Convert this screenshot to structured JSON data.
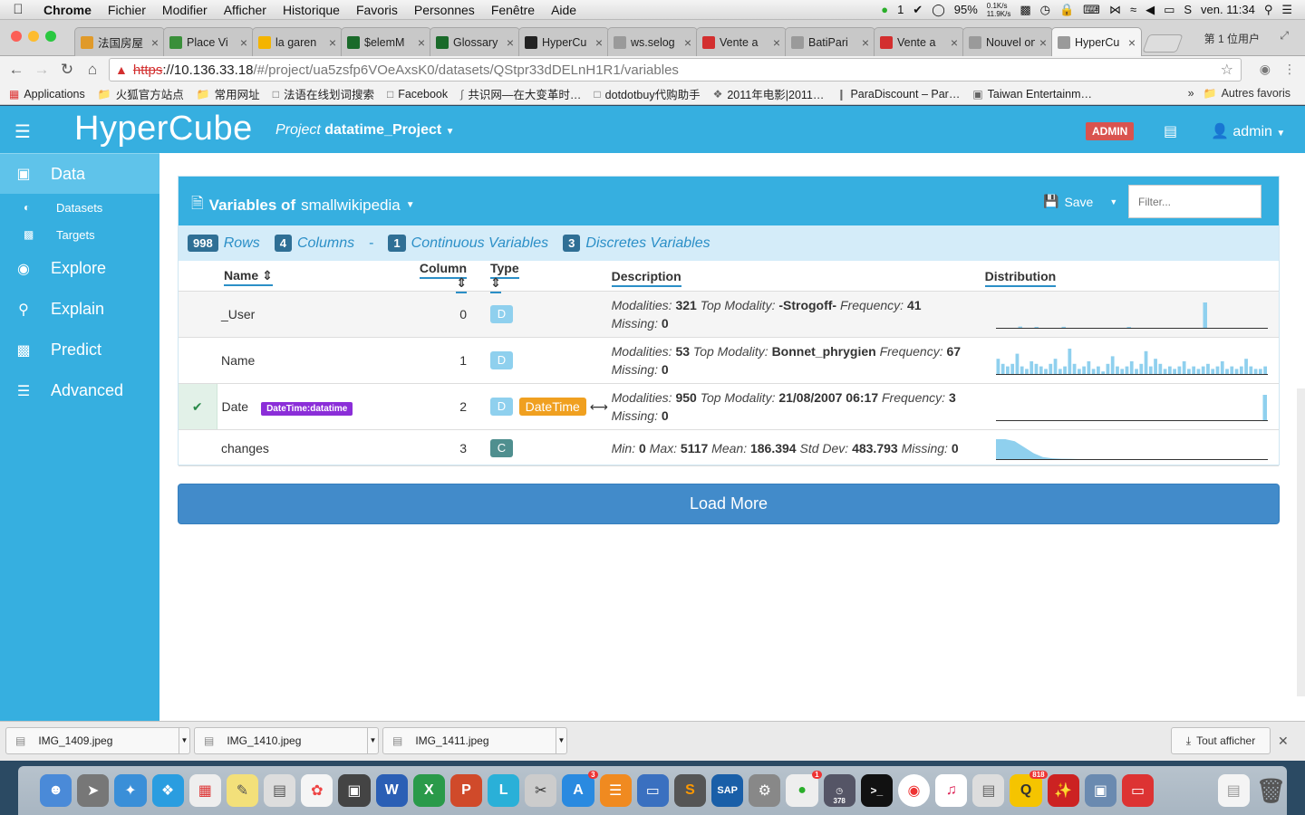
{
  "menubar": {
    "items": [
      "Chrome",
      "Fichier",
      "Modifier",
      "Afficher",
      "Historique",
      "Favoris",
      "Personnes",
      "Fenêtre",
      "Aide"
    ],
    "wechat_count": "1",
    "battery": "95%",
    "net_up": "0.1K/s",
    "net_down": "11.9K/s",
    "clock": "ven. 11:34"
  },
  "tabs": [
    {
      "label": "法国房屋",
      "color": "#e09a2a"
    },
    {
      "label": "Place Vi",
      "color": "#3a8f3a"
    },
    {
      "label": "la garen",
      "color": "#f4b400"
    },
    {
      "label": "$elemM",
      "color": "#1a6a2a"
    },
    {
      "label": "Glossary",
      "color": "#1a6a2a"
    },
    {
      "label": "HyperCu",
      "color": "#222222"
    },
    {
      "label": "ws.selog",
      "color": "#9a9a9a"
    },
    {
      "label": "Vente a",
      "color": "#d32f2f"
    },
    {
      "label": "BatiPari",
      "color": "#9a9a9a"
    },
    {
      "label": "Vente a",
      "color": "#d32f2f"
    },
    {
      "label": "Nouvel ong",
      "color": "#9a9a9a"
    },
    {
      "label": "HyperCu",
      "color": "#9a9a9a"
    }
  ],
  "profile_label": "第 1 位用户",
  "address": {
    "proto": "https",
    "host": "://10.136.33.18",
    "path": "/#/project/ua5zsfp6VOeAxsK0/datasets/QStpr33dDELnH1R1/variables"
  },
  "bookmarks": [
    {
      "label": "Applications"
    },
    {
      "label": "火狐官方站点"
    },
    {
      "label": "常用网址"
    },
    {
      "label": "法语在线划词搜索"
    },
    {
      "label": "Facebook"
    },
    {
      "label": "共识网—在大变革时…"
    },
    {
      "label": "dotdotbuy代购助手"
    },
    {
      "label": "2011年电影|2011…"
    },
    {
      "label": "ParaDiscount – Par…"
    },
    {
      "label": "Taiwan Entertainm…"
    }
  ],
  "bookmarks_more": "»",
  "bookmarks_other": "Autres favoris",
  "header": {
    "brand": "HyperCube",
    "project_label": "Project",
    "project_name": "datatime_Project",
    "admin_badge": "ADMIN",
    "user": "admin"
  },
  "sidebar": {
    "data": "Data",
    "datasets": "Datasets",
    "targets": "Targets",
    "explore": "Explore",
    "explain": "Explain",
    "predict": "Predict",
    "advanced": "Advanced"
  },
  "panel": {
    "title_prefix": "Variables of",
    "dataset_name": "smallwikipedia",
    "save_label": "Save",
    "filter_placeholder": "Filter...",
    "stats": {
      "rows_count": "998",
      "rows_label": "Rows",
      "cols_count": "4",
      "cols_label": "Columns",
      "sep": "-",
      "cont_count": "1",
      "cont_label": "Continuous Variables",
      "disc_count": "3",
      "disc_label": "Discretes Variables"
    },
    "columns": {
      "name": "Name",
      "column": "Column",
      "type": "Type",
      "description": "Description",
      "distribution": "Distribution"
    }
  },
  "variables": [
    {
      "name": "_User",
      "index": "0",
      "type": "D",
      "modalities": "321",
      "top_modality": "-Strogoff-",
      "frequency": "41",
      "missing": "0",
      "dist": [
        0,
        0,
        0,
        0,
        0.05,
        0,
        0,
        0.03,
        0,
        0,
        0,
        0,
        0.04,
        0,
        0,
        0,
        0,
        0,
        0,
        0,
        0,
        0,
        0,
        0,
        0.03,
        0,
        0,
        0,
        0,
        0,
        0,
        0,
        0,
        0,
        0,
        0,
        0,
        0,
        1,
        0,
        0,
        0,
        0,
        0,
        0,
        0,
        0,
        0,
        0,
        0
      ]
    },
    {
      "name": "Name",
      "index": "1",
      "type": "D",
      "modalities": "53",
      "top_modality": "Bonnet_phrygien",
      "frequency": "67",
      "missing": "0",
      "dist": [
        0.6,
        0.4,
        0.3,
        0.4,
        0.8,
        0.3,
        0.2,
        0.5,
        0.4,
        0.3,
        0.2,
        0.4,
        0.6,
        0.2,
        0.3,
        1.0,
        0.4,
        0.2,
        0.3,
        0.5,
        0.2,
        0.3,
        0.1,
        0.4,
        0.7,
        0.3,
        0.2,
        0.3,
        0.5,
        0.2,
        0.4,
        0.9,
        0.3,
        0.6,
        0.4,
        0.2,
        0.3,
        0.2,
        0.3,
        0.5,
        0.2,
        0.3,
        0.2,
        0.3,
        0.4,
        0.2,
        0.3,
        0.5,
        0.2,
        0.3,
        0.2,
        0.3,
        0.6,
        0.3,
        0.2,
        0.2,
        0.3
      ]
    },
    {
      "name": "Date",
      "index": "2",
      "type": "D",
      "special_badge": "DateTime:datatime",
      "dtype": "DateTime",
      "dtype_arrow": "⟷",
      "modalities": "950",
      "top_modality": "21/08/2007 06:17",
      "frequency": "3",
      "missing": "0",
      "selected": true,
      "dist": [
        0,
        0,
        0,
        0,
        0,
        0,
        0,
        0,
        0,
        0,
        0,
        0,
        0,
        0,
        0,
        0,
        0,
        0,
        0,
        0,
        0,
        0,
        0,
        0,
        0,
        0,
        0,
        0,
        0,
        0,
        0,
        0,
        0,
        0,
        0,
        0,
        0,
        0,
        0,
        0,
        0,
        0,
        0,
        0,
        0,
        0,
        0,
        0,
        0,
        1
      ]
    },
    {
      "name": "changes",
      "index": "3",
      "type": "C",
      "min": "0",
      "max": "5117",
      "mean": "186.394",
      "std": "483.793",
      "missing": "0",
      "curve": [
        1,
        1,
        0.9,
        0.6,
        0.3,
        0.1,
        0.04,
        0.02,
        0.01,
        0,
        0,
        0,
        0,
        0,
        0,
        0,
        0,
        0,
        0,
        0,
        0,
        0,
        0,
        0,
        0,
        0,
        0,
        0,
        0,
        0
      ]
    }
  ],
  "labels": {
    "modalities": "Modalities:",
    "top_modality": "Top Modality:",
    "frequency": "Frequency:",
    "missing": "Missing:",
    "min": "Min:",
    "max": "Max:",
    "mean": "Mean:",
    "std": "Std Dev:"
  },
  "load_more": "Load More",
  "downloads": [
    {
      "file": "IMG_1409.jpeg"
    },
    {
      "file": "IMG_1410.jpeg"
    },
    {
      "file": "IMG_1411.jpeg"
    }
  ],
  "show_all": "Tout afficher",
  "dock_badges": {
    "appstore": "3",
    "wechat": "1",
    "calendar": "378",
    "qq": "818"
  },
  "colors": {
    "brand_blue": "#36afe0",
    "stats_bg": "#d4ecf9",
    "load_more": "#428bca",
    "admin_red": "#d9534f",
    "datetime_purple": "#8b2ed8",
    "dtype_orange": "#f0a020"
  }
}
